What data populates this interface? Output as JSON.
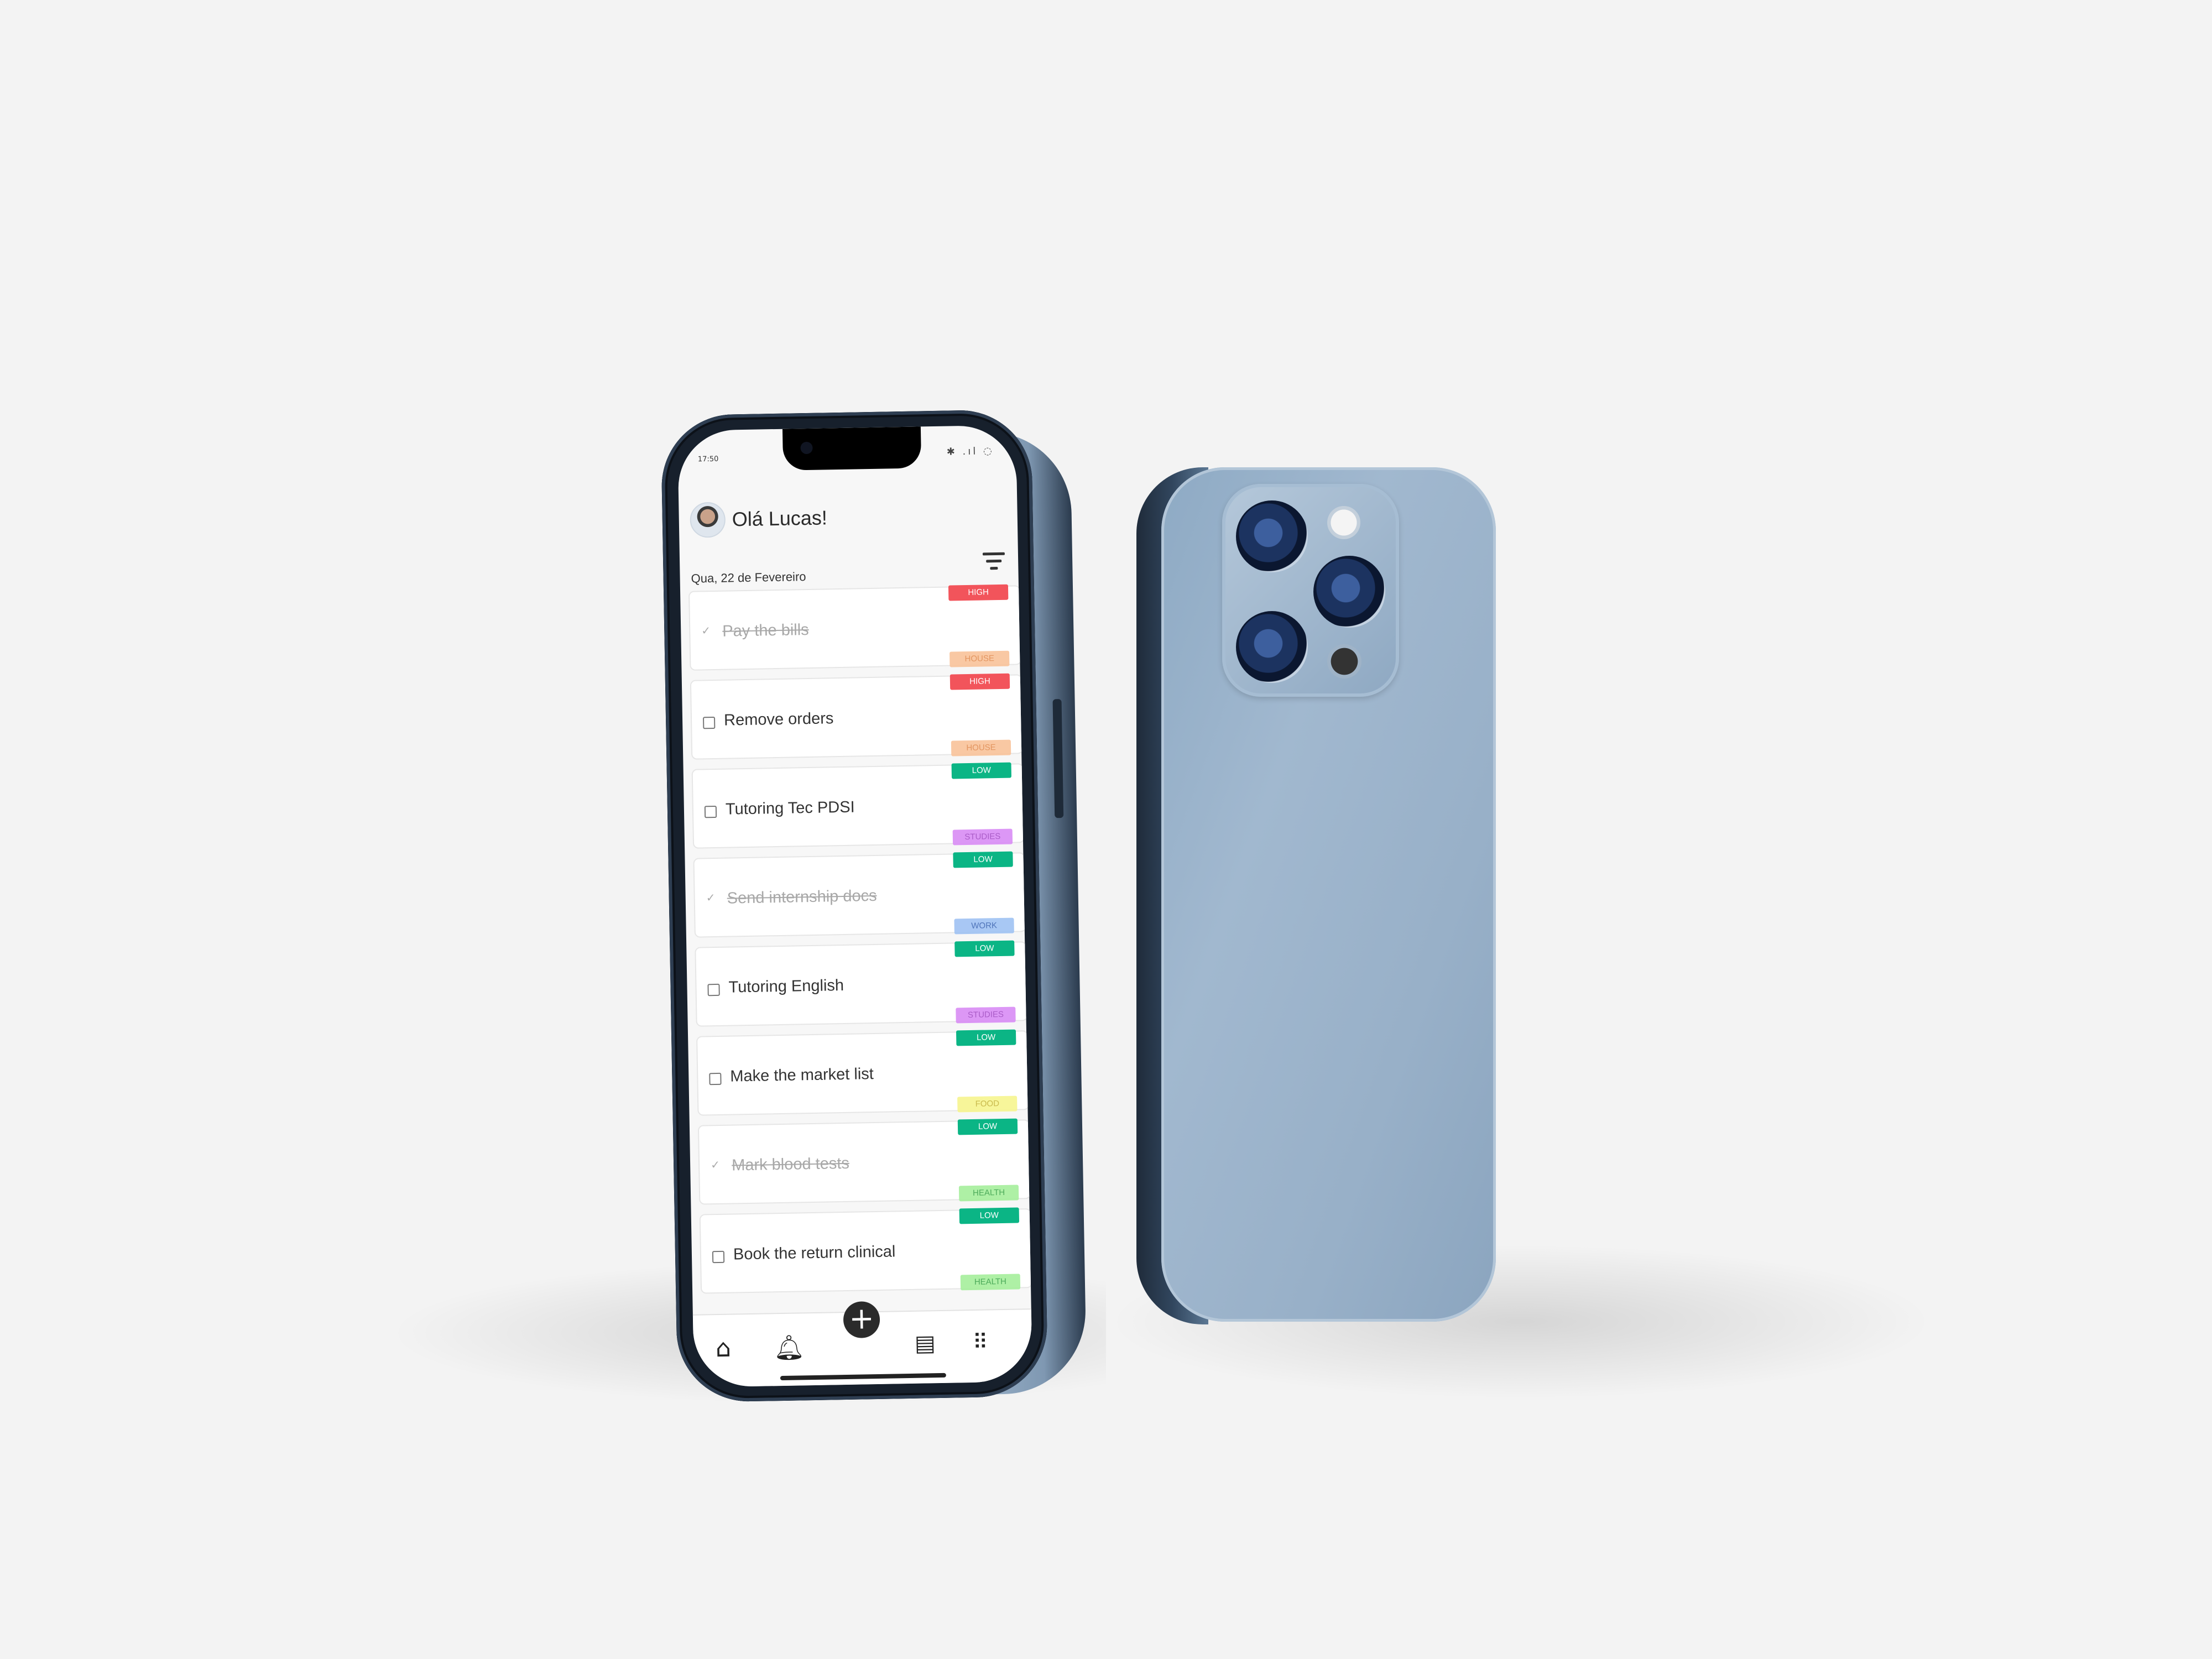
{
  "status_bar": {
    "time": "17:50",
    "icons": "✱ .ıl ◌"
  },
  "header": {
    "greeting": "Olá Lucas!",
    "date": "Qua, 22 de Fevereiro"
  },
  "tasks": [
    {
      "label": "Pay the bills",
      "done": true,
      "priority": "HIGH",
      "category": "HOUSE"
    },
    {
      "label": "Remove orders",
      "done": false,
      "priority": "HIGH",
      "category": "HOUSE"
    },
    {
      "label": "Tutoring Tec PDSI",
      "done": false,
      "priority": "LOW",
      "category": "STUDIES"
    },
    {
      "label": "Send internship docs",
      "done": true,
      "priority": "LOW",
      "category": "WORK"
    },
    {
      "label": "Tutoring English",
      "done": false,
      "priority": "LOW",
      "category": "STUDIES"
    },
    {
      "label": "Make the market list",
      "done": false,
      "priority": "LOW",
      "category": "FOOD"
    },
    {
      "label": "Mark blood tests",
      "done": true,
      "priority": "LOW",
      "category": "HEALTH"
    },
    {
      "label": "Book the return clinical",
      "done": false,
      "priority": "LOW",
      "category": "HEALTH"
    }
  ],
  "colors": {
    "HIGH": "#f2545b",
    "LOW": "#0bb585",
    "HOUSE": "#f9c39a",
    "STUDIES": "#d98cf5",
    "WORK": "#9fc2f3",
    "FOOD": "#f7f58f",
    "HEALTH": "#a6ef9c",
    "HOUSE_text": "#e08a4f",
    "STUDIES_text": "#a14bc2",
    "WORK_text": "#3d66b3",
    "FOOD_text": "#c4b33a",
    "HEALTH_text": "#3ba34a"
  },
  "nav": {
    "items": [
      "home-icon",
      "bell-icon",
      "add-icon",
      "calendar-icon",
      "apps-grid-icon"
    ],
    "add_glyph": "+"
  }
}
